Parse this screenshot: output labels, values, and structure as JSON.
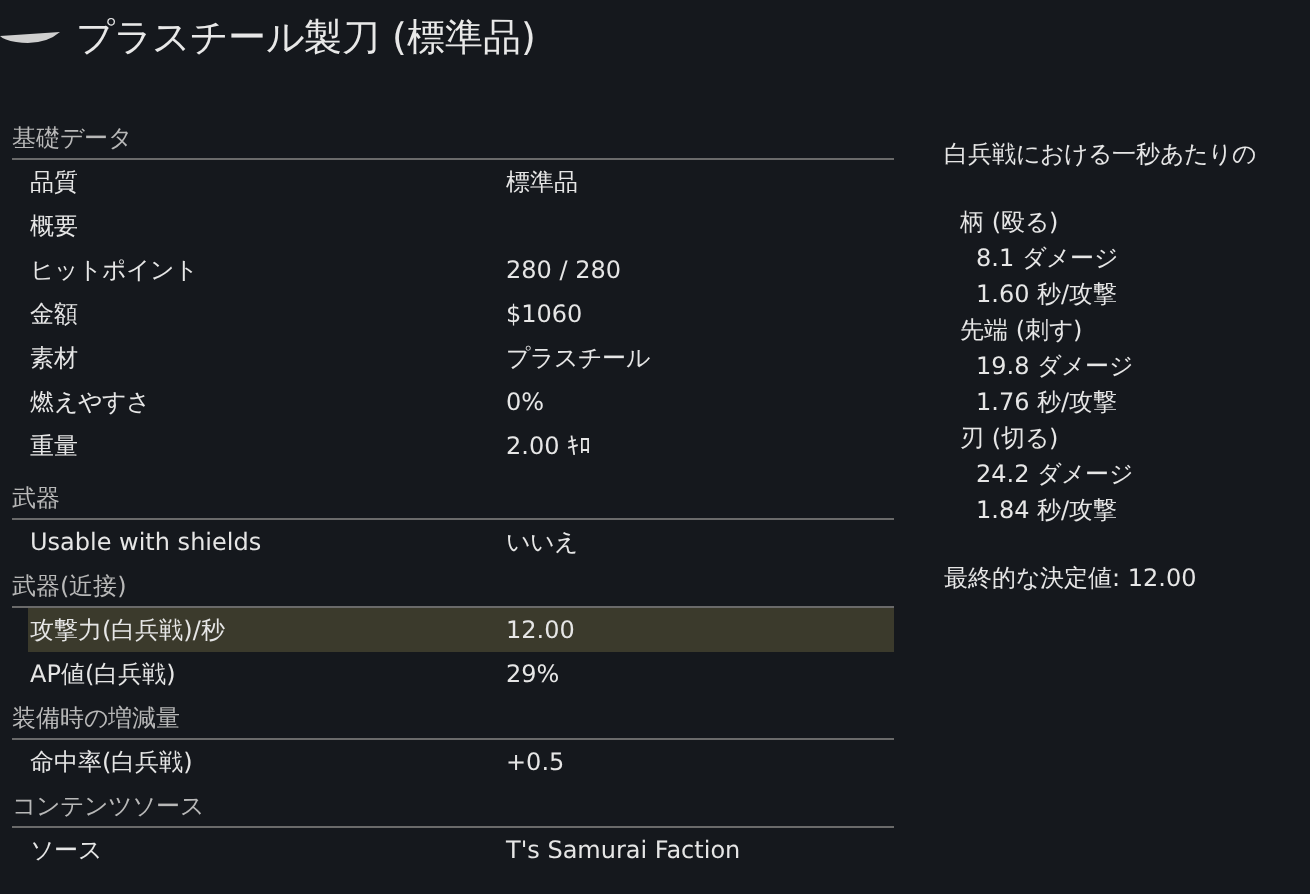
{
  "title": "プラスチール製刀 (標準品)",
  "sections": [
    {
      "heading": "基礎データ",
      "rows": [
        {
          "label": "品質",
          "value": "標準品",
          "selected": false
        },
        {
          "label": "概要",
          "value": null,
          "selected": false
        },
        {
          "label": "ヒットポイント",
          "value": "280 / 280",
          "selected": false
        },
        {
          "label": "金額",
          "value": "$1060",
          "selected": false
        },
        {
          "label": "素材",
          "value": "プラスチール",
          "selected": false
        },
        {
          "label": "燃えやすさ",
          "value": "0%",
          "selected": false
        },
        {
          "label": "重量",
          "value": "2.00 ｷﾛ",
          "selected": false
        }
      ]
    },
    {
      "heading": "武器",
      "rows": [
        {
          "label": "Usable with shields",
          "value": "いいえ",
          "selected": false
        }
      ]
    },
    {
      "heading": "武器(近接)",
      "rows": [
        {
          "label": "攻撃力(白兵戦)/秒",
          "value": "12.00",
          "selected": true
        },
        {
          "label": "AP値(白兵戦)",
          "value": "29%",
          "selected": false
        }
      ]
    },
    {
      "heading": "装備時の増減量",
      "rows": [
        {
          "label": "命中率(白兵戦)",
          "value": "+0.5",
          "selected": false
        }
      ]
    },
    {
      "heading": "コンテンツソース",
      "rows": [
        {
          "label": "ソース",
          "value": "T's Samurai Faction",
          "selected": false
        }
      ]
    }
  ],
  "detail": {
    "heading": "白兵戦における一秒あたりの",
    "parts": [
      {
        "name": "柄 (殴る)",
        "damage": "8.1 ダメージ",
        "cooldown": "1.60 秒/攻撃"
      },
      {
        "name": "先端 (刺す)",
        "damage": "19.8 ダメージ",
        "cooldown": "1.76 秒/攻撃"
      },
      {
        "name": "刃 (切る)",
        "damage": "24.2 ダメージ",
        "cooldown": "1.84 秒/攻撃"
      }
    ],
    "final": "最終的な決定値: 12.00"
  }
}
